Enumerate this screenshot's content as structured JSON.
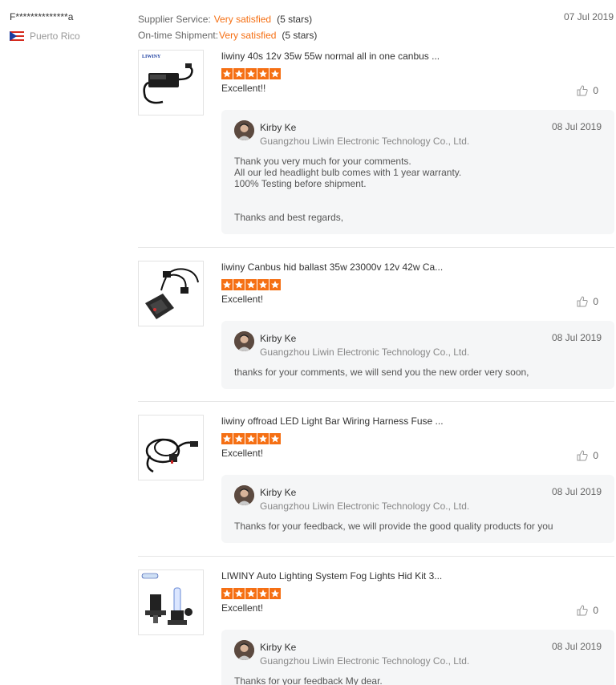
{
  "buyer": {
    "name": "F**************a",
    "country": "Puerto Rico"
  },
  "ratings": {
    "supplier_label": "Supplier Service:",
    "supplier_value": "Very satisfied",
    "supplier_stars": "(5 stars)",
    "shipment_label": "On-time Shipment:",
    "shipment_value": "Very satisfied",
    "shipment_stars": "(5 stars)",
    "date": "07 Jul 2019"
  },
  "colors": {
    "accent": "#f56f13",
    "reply_bg": "#f5f6f7"
  },
  "reviews": [
    {
      "title": "liwiny 40s 12v 35w 55w normal all in one canbus ...",
      "stars": 5,
      "comment": "Excellent!!",
      "likes": "0",
      "image": "hid-ballast-box",
      "reply": {
        "name": "Kirby Ke",
        "company": "Guangzhou Liwin Electronic Technology Co., Ltd.",
        "date": "08 Jul 2019",
        "text": "Thank you very much for your comments.\nAll our led headlight bulb comes with 1 year warranty.\n100% Testing before shipment.\n\n\nThanks and best regards,"
      }
    },
    {
      "title": "liwiny Canbus hid ballast 35w 23000v 12v 42w Ca...",
      "stars": 5,
      "comment": "Excellent!",
      "likes": "0",
      "image": "canbus-ballast",
      "reply": {
        "name": "Kirby Ke",
        "company": "Guangzhou Liwin Electronic Technology Co., Ltd.",
        "date": "08 Jul 2019",
        "text": "thanks for your comments, we will send you the new order very soon,"
      }
    },
    {
      "title": "liwiny offroad LED Light Bar Wiring Harness Fuse ...",
      "stars": 5,
      "comment": "Excellent!",
      "likes": "0",
      "image": "wiring-harness",
      "reply": {
        "name": "Kirby Ke",
        "company": "Guangzhou Liwin Electronic Technology Co., Ltd.",
        "date": "08 Jul 2019",
        "text": "Thanks for your feedback, we will provide the good quality products for you"
      }
    },
    {
      "title": "LIWINY Auto Lighting System Fog Lights Hid Kit 3...",
      "stars": 5,
      "comment": "Excellent!",
      "likes": "0",
      "image": "hid-bulbs",
      "reply": {
        "name": "Kirby Ke",
        "company": "Guangzhou Liwin Electronic Technology Co., Ltd.",
        "date": "08 Jul 2019",
        "text": "Thanks for your feedback My dear."
      }
    }
  ]
}
